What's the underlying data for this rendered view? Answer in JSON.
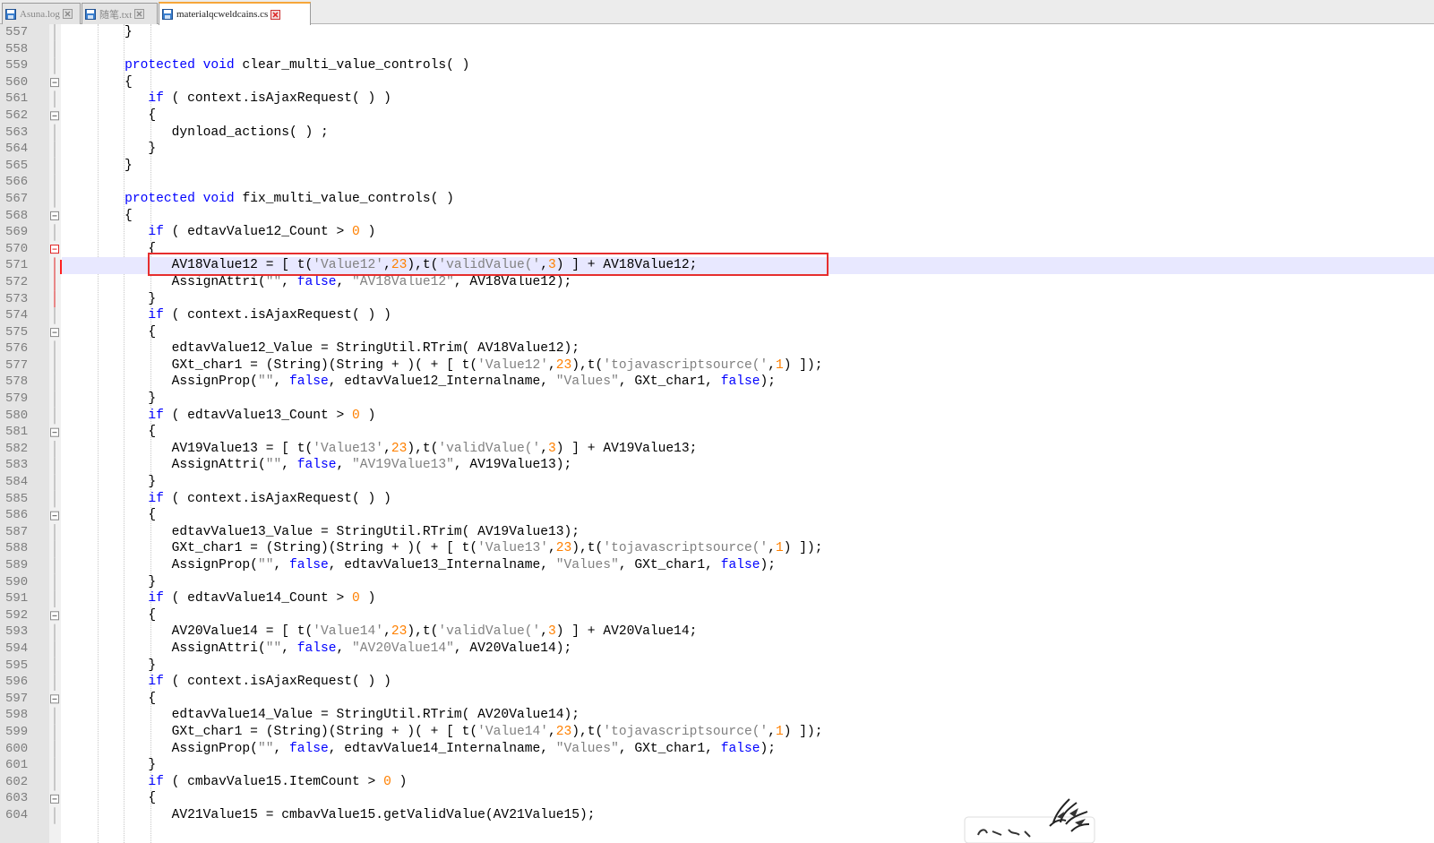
{
  "tabs": [
    {
      "label": "Asuna.log",
      "active": false
    },
    {
      "label": "随笔.txt",
      "active": false
    },
    {
      "label": "materialqcweldcains.cs",
      "active": true
    }
  ],
  "colors": {
    "keyword": "#0000ff",
    "string": "#808080",
    "number": "#ff8000",
    "highlight_box": "#e62e2e",
    "current_line": "#e8e8ff"
  },
  "icons": [
    "file-icon",
    "close-icon",
    "fold-minus-icon",
    "watermark-logo"
  ],
  "current_line": "571",
  "lines": [
    {
      "num": "557",
      "tokens": [
        [
          "p",
          "        }"
        ]
      ]
    },
    {
      "num": "558",
      "tokens": []
    },
    {
      "num": "559",
      "tokens": [
        [
          "p",
          "        "
        ],
        [
          "kw",
          "protected"
        ],
        [
          "p",
          " "
        ],
        [
          "kw",
          "void"
        ],
        [
          "p",
          " clear_multi_value_controls( )"
        ]
      ]
    },
    {
      "num": "560",
      "tokens": [
        [
          "p",
          "        {"
        ]
      ]
    },
    {
      "num": "561",
      "tokens": [
        [
          "p",
          "           "
        ],
        [
          "kw",
          "if"
        ],
        [
          "p",
          " ( context.isAjaxRequest( ) )"
        ]
      ]
    },
    {
      "num": "562",
      "tokens": [
        [
          "p",
          "           {"
        ]
      ]
    },
    {
      "num": "563",
      "tokens": [
        [
          "p",
          "              dynload_actions( ) ;"
        ]
      ]
    },
    {
      "num": "564",
      "tokens": [
        [
          "p",
          "           }"
        ]
      ]
    },
    {
      "num": "565",
      "tokens": [
        [
          "p",
          "        }"
        ]
      ]
    },
    {
      "num": "566",
      "tokens": []
    },
    {
      "num": "567",
      "tokens": [
        [
          "p",
          "        "
        ],
        [
          "kw",
          "protected"
        ],
        [
          "p",
          " "
        ],
        [
          "kw",
          "void"
        ],
        [
          "p",
          " fix_multi_value_controls( )"
        ]
      ]
    },
    {
      "num": "568",
      "tokens": [
        [
          "p",
          "        {"
        ]
      ]
    },
    {
      "num": "569",
      "tokens": [
        [
          "p",
          "           "
        ],
        [
          "kw",
          "if"
        ],
        [
          "p",
          " ( edtavValue12_Count > "
        ],
        [
          "num",
          "0"
        ],
        [
          "p",
          " )"
        ]
      ]
    },
    {
      "num": "570",
      "tokens": [
        [
          "p",
          "           {"
        ]
      ]
    },
    {
      "num": "571",
      "tokens": [
        [
          "p",
          "              AV18Value12 = [ t("
        ],
        [
          "str",
          "'Value12'"
        ],
        [
          "p",
          ","
        ],
        [
          "num",
          "23"
        ],
        [
          "p",
          "),t("
        ],
        [
          "str",
          "'validValue('"
        ],
        [
          "p",
          ","
        ],
        [
          "num",
          "3"
        ],
        [
          "p",
          ") ] + AV18Value12;"
        ]
      ]
    },
    {
      "num": "572",
      "tokens": [
        [
          "p",
          "              AssignAttri("
        ],
        [
          "str",
          "\"\""
        ],
        [
          "p",
          ", "
        ],
        [
          "kw",
          "false"
        ],
        [
          "p",
          ", "
        ],
        [
          "str",
          "\"AV18Value12\""
        ],
        [
          "p",
          ", AV18Value12);"
        ]
      ]
    },
    {
      "num": "573",
      "tokens": [
        [
          "p",
          "           }"
        ]
      ]
    },
    {
      "num": "574",
      "tokens": [
        [
          "p",
          "           "
        ],
        [
          "kw",
          "if"
        ],
        [
          "p",
          " ( context.isAjaxRequest( ) )"
        ]
      ]
    },
    {
      "num": "575",
      "tokens": [
        [
          "p",
          "           {"
        ]
      ]
    },
    {
      "num": "576",
      "tokens": [
        [
          "p",
          "              edtavValue12_Value = StringUtil.RTrim( AV18Value12);"
        ]
      ]
    },
    {
      "num": "577",
      "tokens": [
        [
          "p",
          "              GXt_char1 = (String)(String + )( + [ t("
        ],
        [
          "str",
          "'Value12'"
        ],
        [
          "p",
          ","
        ],
        [
          "num",
          "23"
        ],
        [
          "p",
          "),t("
        ],
        [
          "str",
          "'tojavascriptsource('"
        ],
        [
          "p",
          ","
        ],
        [
          "num",
          "1"
        ],
        [
          "p",
          ") ]);"
        ]
      ]
    },
    {
      "num": "578",
      "tokens": [
        [
          "p",
          "              AssignProp("
        ],
        [
          "str",
          "\"\""
        ],
        [
          "p",
          ", "
        ],
        [
          "kw",
          "false"
        ],
        [
          "p",
          ", edtavValue12_Internalname, "
        ],
        [
          "str",
          "\"Values\""
        ],
        [
          "p",
          ", GXt_char1, "
        ],
        [
          "kw",
          "false"
        ],
        [
          "p",
          ");"
        ]
      ]
    },
    {
      "num": "579",
      "tokens": [
        [
          "p",
          "           }"
        ]
      ]
    },
    {
      "num": "580",
      "tokens": [
        [
          "p",
          "           "
        ],
        [
          "kw",
          "if"
        ],
        [
          "p",
          " ( edtavValue13_Count > "
        ],
        [
          "num",
          "0"
        ],
        [
          "p",
          " )"
        ]
      ]
    },
    {
      "num": "581",
      "tokens": [
        [
          "p",
          "           {"
        ]
      ]
    },
    {
      "num": "582",
      "tokens": [
        [
          "p",
          "              AV19Value13 = [ t("
        ],
        [
          "str",
          "'Value13'"
        ],
        [
          "p",
          ","
        ],
        [
          "num",
          "23"
        ],
        [
          "p",
          "),t("
        ],
        [
          "str",
          "'validValue('"
        ],
        [
          "p",
          ","
        ],
        [
          "num",
          "3"
        ],
        [
          "p",
          ") ] + AV19Value13;"
        ]
      ]
    },
    {
      "num": "583",
      "tokens": [
        [
          "p",
          "              AssignAttri("
        ],
        [
          "str",
          "\"\""
        ],
        [
          "p",
          ", "
        ],
        [
          "kw",
          "false"
        ],
        [
          "p",
          ", "
        ],
        [
          "str",
          "\"AV19Value13\""
        ],
        [
          "p",
          ", AV19Value13);"
        ]
      ]
    },
    {
      "num": "584",
      "tokens": [
        [
          "p",
          "           }"
        ]
      ]
    },
    {
      "num": "585",
      "tokens": [
        [
          "p",
          "           "
        ],
        [
          "kw",
          "if"
        ],
        [
          "p",
          " ( context.isAjaxRequest( ) )"
        ]
      ]
    },
    {
      "num": "586",
      "tokens": [
        [
          "p",
          "           {"
        ]
      ]
    },
    {
      "num": "587",
      "tokens": [
        [
          "p",
          "              edtavValue13_Value = StringUtil.RTrim( AV19Value13);"
        ]
      ]
    },
    {
      "num": "588",
      "tokens": [
        [
          "p",
          "              GXt_char1 = (String)(String + )( + [ t("
        ],
        [
          "str",
          "'Value13'"
        ],
        [
          "p",
          ","
        ],
        [
          "num",
          "23"
        ],
        [
          "p",
          "),t("
        ],
        [
          "str",
          "'tojavascriptsource('"
        ],
        [
          "p",
          ","
        ],
        [
          "num",
          "1"
        ],
        [
          "p",
          ") ]);"
        ]
      ]
    },
    {
      "num": "589",
      "tokens": [
        [
          "p",
          "              AssignProp("
        ],
        [
          "str",
          "\"\""
        ],
        [
          "p",
          ", "
        ],
        [
          "kw",
          "false"
        ],
        [
          "p",
          ", edtavValue13_Internalname, "
        ],
        [
          "str",
          "\"Values\""
        ],
        [
          "p",
          ", GXt_char1, "
        ],
        [
          "kw",
          "false"
        ],
        [
          "p",
          ");"
        ]
      ]
    },
    {
      "num": "590",
      "tokens": [
        [
          "p",
          "           }"
        ]
      ]
    },
    {
      "num": "591",
      "tokens": [
        [
          "p",
          "           "
        ],
        [
          "kw",
          "if"
        ],
        [
          "p",
          " ( edtavValue14_Count > "
        ],
        [
          "num",
          "0"
        ],
        [
          "p",
          " )"
        ]
      ]
    },
    {
      "num": "592",
      "tokens": [
        [
          "p",
          "           {"
        ]
      ]
    },
    {
      "num": "593",
      "tokens": [
        [
          "p",
          "              AV20Value14 = [ t("
        ],
        [
          "str",
          "'Value14'"
        ],
        [
          "p",
          ","
        ],
        [
          "num",
          "23"
        ],
        [
          "p",
          "),t("
        ],
        [
          "str",
          "'validValue('"
        ],
        [
          "p",
          ","
        ],
        [
          "num",
          "3"
        ],
        [
          "p",
          ") ] + AV20Value14;"
        ]
      ]
    },
    {
      "num": "594",
      "tokens": [
        [
          "p",
          "              AssignAttri("
        ],
        [
          "str",
          "\"\""
        ],
        [
          "p",
          ", "
        ],
        [
          "kw",
          "false"
        ],
        [
          "p",
          ", "
        ],
        [
          "str",
          "\"AV20Value14\""
        ],
        [
          "p",
          ", AV20Value14);"
        ]
      ]
    },
    {
      "num": "595",
      "tokens": [
        [
          "p",
          "           }"
        ]
      ]
    },
    {
      "num": "596",
      "tokens": [
        [
          "p",
          "           "
        ],
        [
          "kw",
          "if"
        ],
        [
          "p",
          " ( context.isAjaxRequest( ) )"
        ]
      ]
    },
    {
      "num": "597",
      "tokens": [
        [
          "p",
          "           {"
        ]
      ]
    },
    {
      "num": "598",
      "tokens": [
        [
          "p",
          "              edtavValue14_Value = StringUtil.RTrim( AV20Value14);"
        ]
      ]
    },
    {
      "num": "599",
      "tokens": [
        [
          "p",
          "              GXt_char1 = (String)(String + )( + [ t("
        ],
        [
          "str",
          "'Value14'"
        ],
        [
          "p",
          ","
        ],
        [
          "num",
          "23"
        ],
        [
          "p",
          "),t("
        ],
        [
          "str",
          "'tojavascriptsource('"
        ],
        [
          "p",
          ","
        ],
        [
          "num",
          "1"
        ],
        [
          "p",
          ") ]);"
        ]
      ]
    },
    {
      "num": "600",
      "tokens": [
        [
          "p",
          "              AssignProp("
        ],
        [
          "str",
          "\"\""
        ],
        [
          "p",
          ", "
        ],
        [
          "kw",
          "false"
        ],
        [
          "p",
          ", edtavValue14_Internalname, "
        ],
        [
          "str",
          "\"Values\""
        ],
        [
          "p",
          ", GXt_char1, "
        ],
        [
          "kw",
          "false"
        ],
        [
          "p",
          ");"
        ]
      ]
    },
    {
      "num": "601",
      "tokens": [
        [
          "p",
          "           }"
        ]
      ]
    },
    {
      "num": "602",
      "tokens": [
        [
          "p",
          "           "
        ],
        [
          "kw",
          "if"
        ],
        [
          "p",
          " ( cmbavValue15.ItemCount > "
        ],
        [
          "num",
          "0"
        ],
        [
          "p",
          " )"
        ]
      ]
    },
    {
      "num": "603",
      "tokens": [
        [
          "p",
          "           {"
        ]
      ]
    },
    {
      "num": "604",
      "tokens": [
        [
          "p",
          "              AV21Value15 = cmbavValue15.getValidValue(AV21Value15);"
        ]
      ]
    }
  ]
}
